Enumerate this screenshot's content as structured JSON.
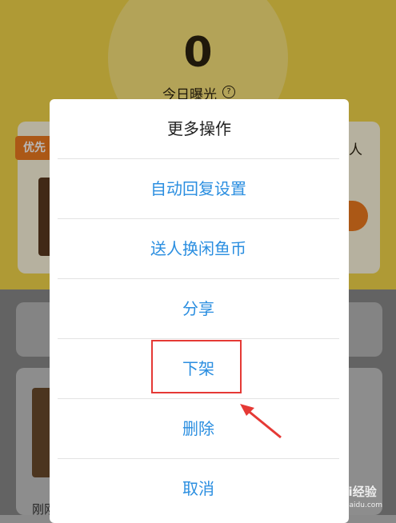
{
  "background": {
    "exposure_count": "0",
    "exposure_label": "今日曝光",
    "help_symbol": "?",
    "priority_badge": "优先",
    "right_partial_text": "人",
    "bottom_partial_text": "刚刚"
  },
  "action_sheet": {
    "title": "更多操作",
    "items": [
      {
        "label": "自动回复设置"
      },
      {
        "label": "送人换闲鱼币"
      },
      {
        "label": "分享"
      },
      {
        "label": "下架"
      },
      {
        "label": "删除"
      },
      {
        "label": "取消"
      }
    ],
    "item_color": "#2a8ee0",
    "highlighted_item": "下架",
    "highlight_color": "#e53935"
  },
  "watermark": {
    "text": "Bai经验",
    "subtext": "jingyan.baidu.com"
  }
}
